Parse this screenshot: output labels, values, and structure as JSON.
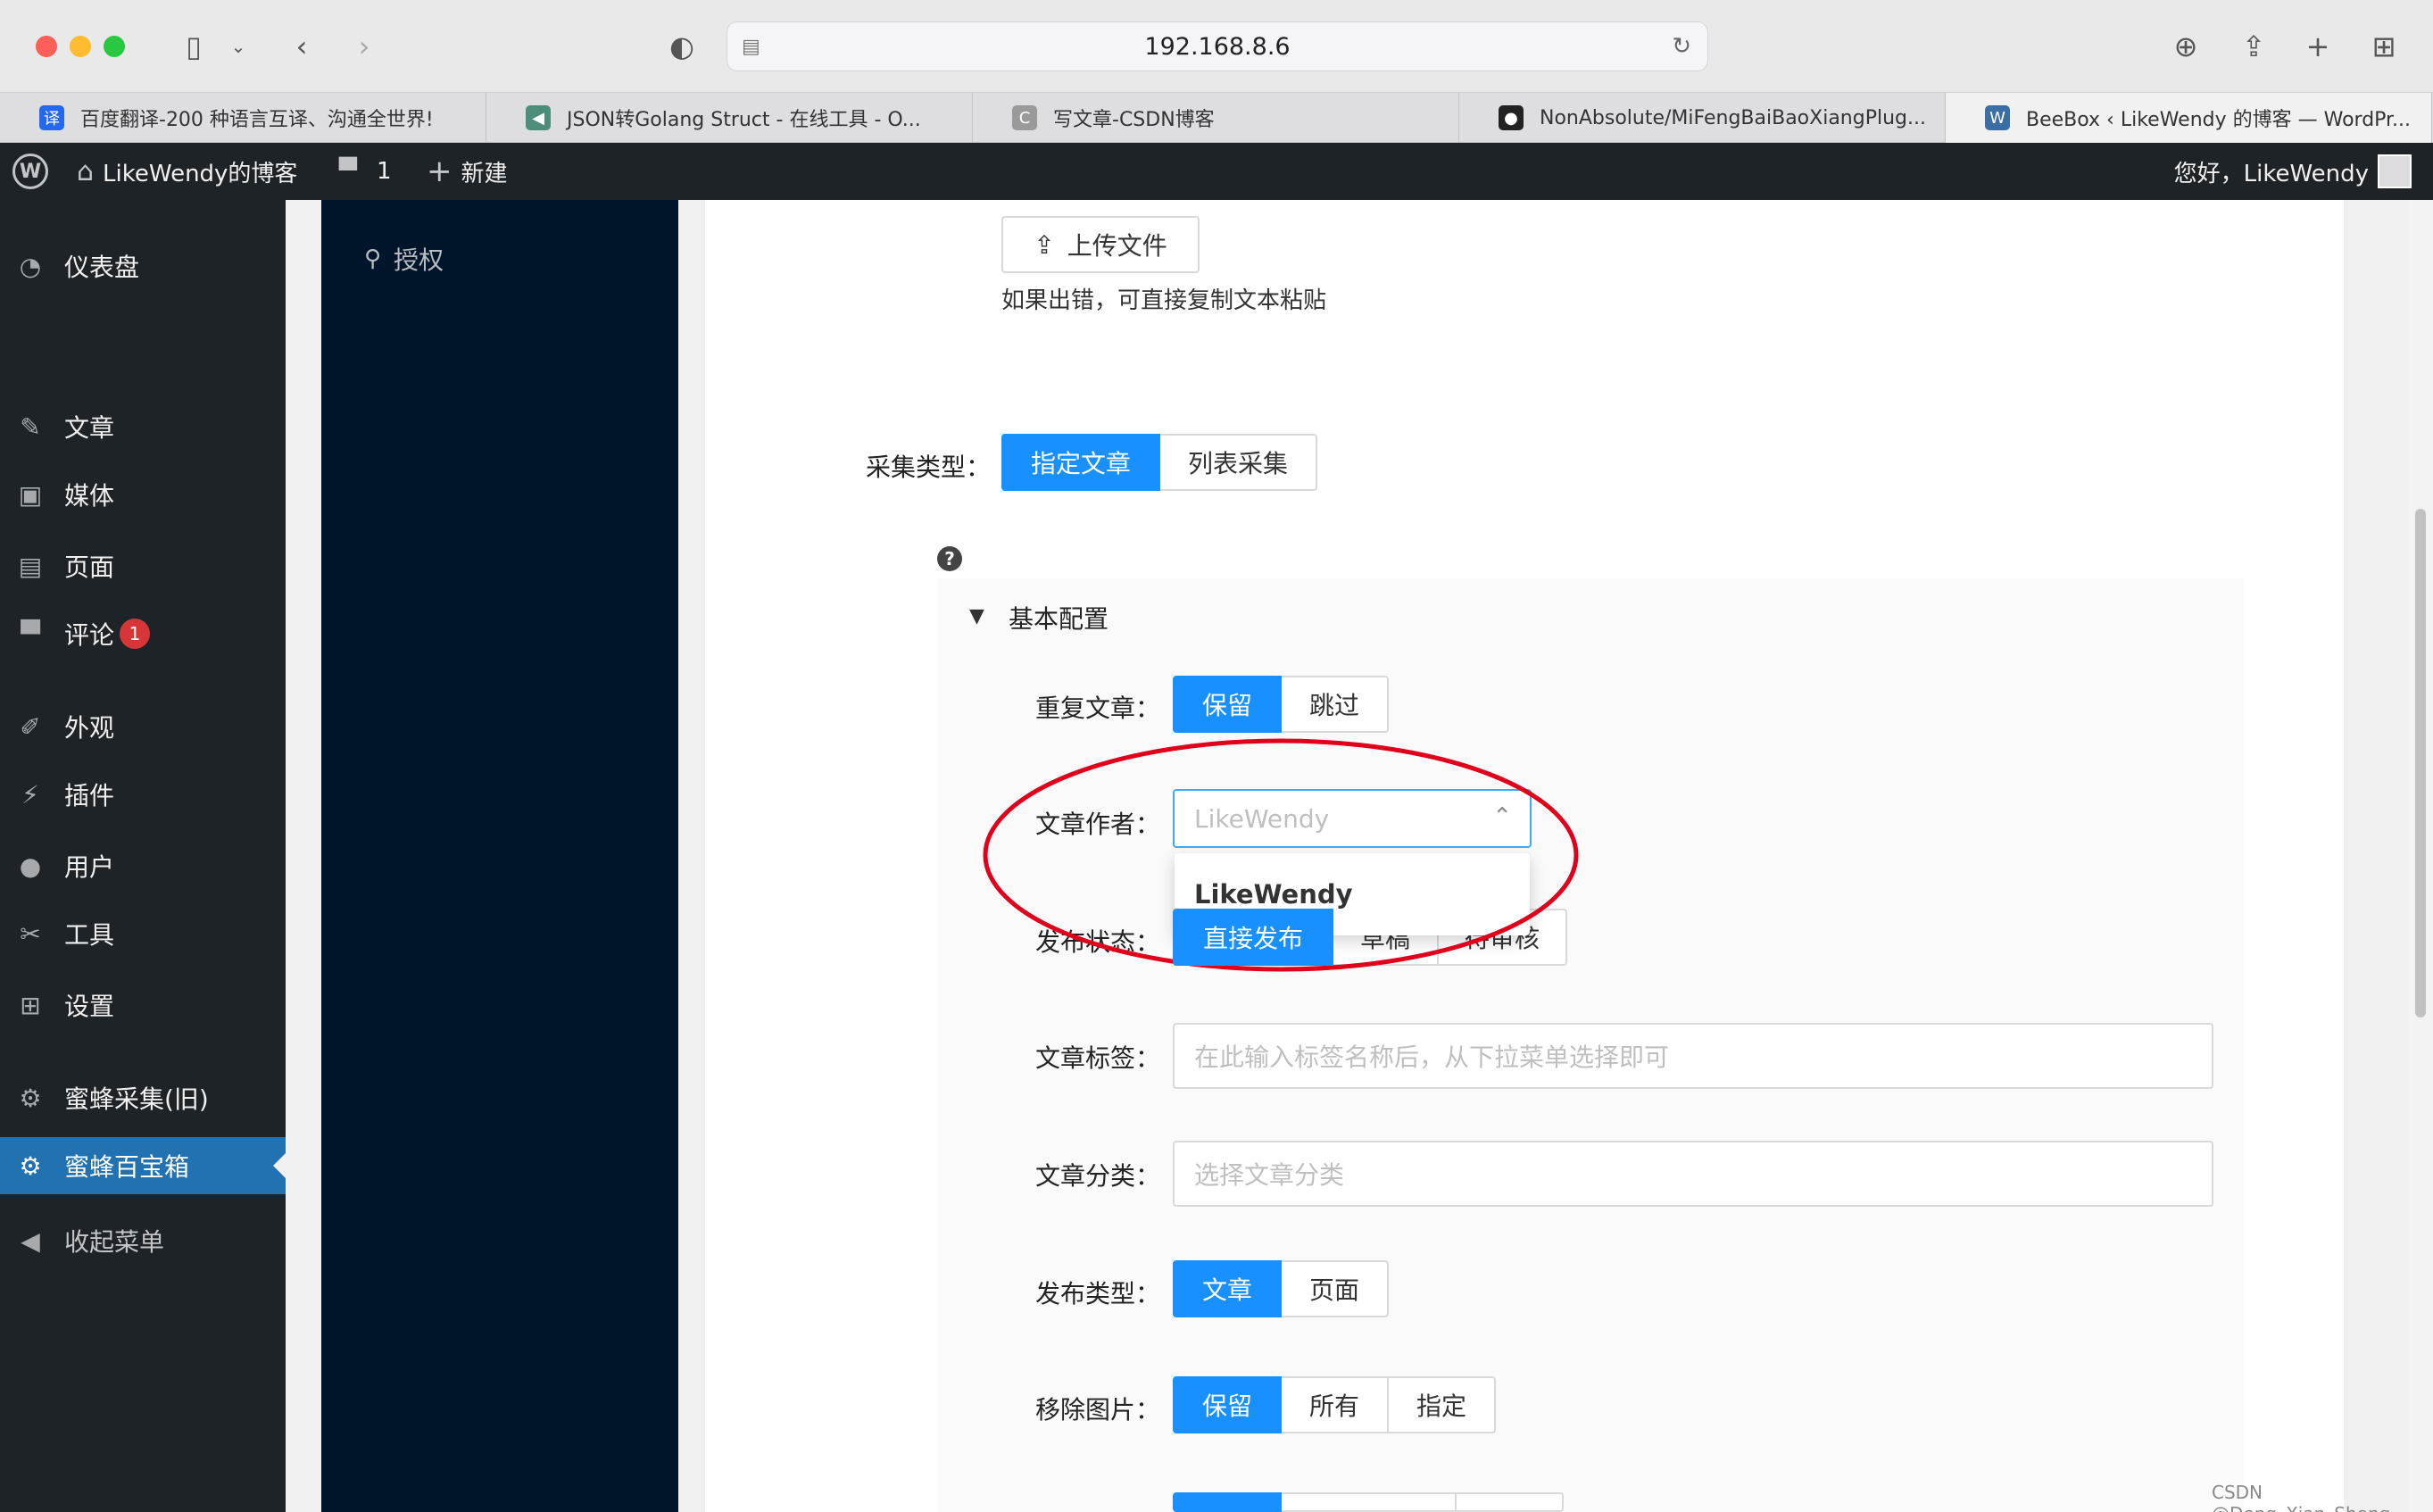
{
  "browser": {
    "url": "192.168.8.6",
    "tabs": [
      {
        "title": "百度翻译-200 种语言互译、沟通全世界!",
        "icon": "baidu-translate-icon",
        "icon_glyph": "译",
        "icon_color": "#2468f2"
      },
      {
        "title": "JSON转Golang Struct - 在线工具 - O...",
        "icon": "json-tool-icon",
        "icon_glyph": "◀",
        "icon_color": "#4c8d7b"
      },
      {
        "title": "写文章-CSDN博客",
        "icon": "csdn-icon",
        "icon_glyph": "C",
        "icon_color": "#9a9a9a"
      },
      {
        "title": "NonAbsolute/MiFengBaiBaoXiangPlug...",
        "icon": "github-icon",
        "icon_glyph": "●",
        "icon_color": "#222222"
      },
      {
        "title": "BeeBox ‹ LikeWendy 的博客 — WordPr...",
        "icon": "wordpress-icon",
        "icon_glyph": "W",
        "icon_color": "#3a6ea5"
      }
    ]
  },
  "adminbar": {
    "site_name": "LikeWendy的博客",
    "comments_count": "1",
    "new_label": "新建",
    "greeting": "您好，LikeWendy"
  },
  "admin_menu": [
    {
      "label": "仪表盘",
      "icon": "dashboard-icon",
      "glyph": "◔"
    },
    {
      "label": "文章",
      "icon": "pin-icon",
      "glyph": "✎"
    },
    {
      "label": "媒体",
      "icon": "media-icon",
      "glyph": "▣"
    },
    {
      "label": "页面",
      "icon": "page-icon",
      "glyph": "▤"
    },
    {
      "label": "评论",
      "icon": "comment-icon",
      "glyph": "▀",
      "badge": "1"
    },
    {
      "label": "外观",
      "icon": "brush-icon",
      "glyph": "✐"
    },
    {
      "label": "插件",
      "icon": "plugin-icon",
      "glyph": "⚡"
    },
    {
      "label": "用户",
      "icon": "user-icon",
      "glyph": "●"
    },
    {
      "label": "工具",
      "icon": "wrench-icon",
      "glyph": "✂"
    },
    {
      "label": "设置",
      "icon": "settings-icon",
      "glyph": "⊞"
    },
    {
      "label": "蜜蜂采集(旧)",
      "icon": "gear-icon",
      "glyph": "⚙"
    },
    {
      "label": "蜜蜂百宝箱",
      "icon": "gear-icon",
      "glyph": "⚙",
      "current": true
    },
    {
      "label": "收起菜单",
      "icon": "collapse-icon",
      "glyph": "◀"
    }
  ],
  "plugin_nav": {
    "auth_label": "授权"
  },
  "form": {
    "upload_label": "上传文件",
    "upload_hint": "如果出错，可直接复制文本粘贴",
    "collect_type_label": "采集类型：",
    "collect_type_options": [
      "指定文章",
      "列表采集"
    ],
    "basic_config_title": "基本配置",
    "duplicate_label": "重复文章：",
    "duplicate_options": [
      "保留",
      "跳过"
    ],
    "author_label": "文章作者：",
    "author_value": "LikeWendy",
    "author_dropdown_option": "LikeWendy",
    "status_label": "发布状态：",
    "status_options": [
      "直接发布",
      "草稿",
      "待审核"
    ],
    "tags_label": "文章标签：",
    "tags_placeholder": "在此输入标签名称后，从下拉菜单选择即可",
    "category_label": "文章分类：",
    "category_placeholder": "选择文章分类",
    "post_type_label": "发布类型：",
    "post_type_options": [
      "文章",
      "页面"
    ],
    "remove_images_label": "移除图片：",
    "remove_images_options": [
      "保留",
      "所有",
      "指定"
    ]
  },
  "watermark": "CSDN @Deng_Xian_Sheng",
  "colors": {
    "primary": "#1890ff",
    "wp_blue": "#2271b1",
    "annotation_red": "#e0001b"
  }
}
